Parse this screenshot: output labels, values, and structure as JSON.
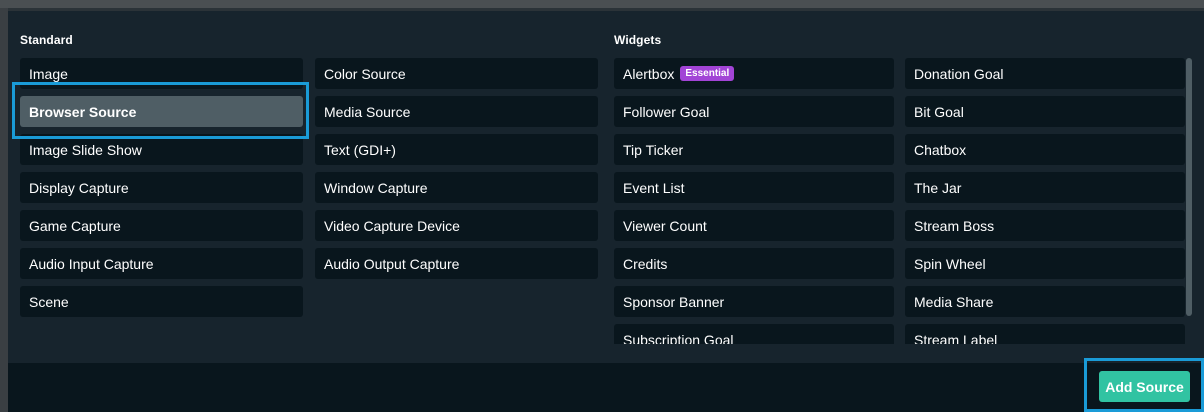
{
  "standard": {
    "title": "Standard",
    "col1": [
      "Image",
      "Browser Source",
      "Image Slide Show",
      "Display Capture",
      "Game Capture",
      "Audio Input Capture",
      "Scene"
    ],
    "col2": [
      "Color Source",
      "Media Source",
      "Text (GDI+)",
      "Window Capture",
      "Video Capture Device",
      "Audio Output Capture"
    ],
    "selected": "Browser Source"
  },
  "widgets": {
    "title": "Widgets",
    "col1": [
      "Alertbox",
      "Follower Goal",
      "Tip Ticker",
      "Event List",
      "Viewer Count",
      "Credits",
      "Sponsor Banner",
      "Subscription Goal"
    ],
    "col2": [
      "Donation Goal",
      "Bit Goal",
      "Chatbox",
      "The Jar",
      "Stream Boss",
      "Spin Wheel",
      "Media Share",
      "Stream Label"
    ],
    "alertbox_badge": "Essential"
  },
  "footer": {
    "add_source_label": "Add Source"
  },
  "colors": {
    "accent_highlight": "#1a9bd7",
    "add_button": "#31c3a2",
    "badge": "#a244d6",
    "selected_item": "#4f5e65"
  }
}
